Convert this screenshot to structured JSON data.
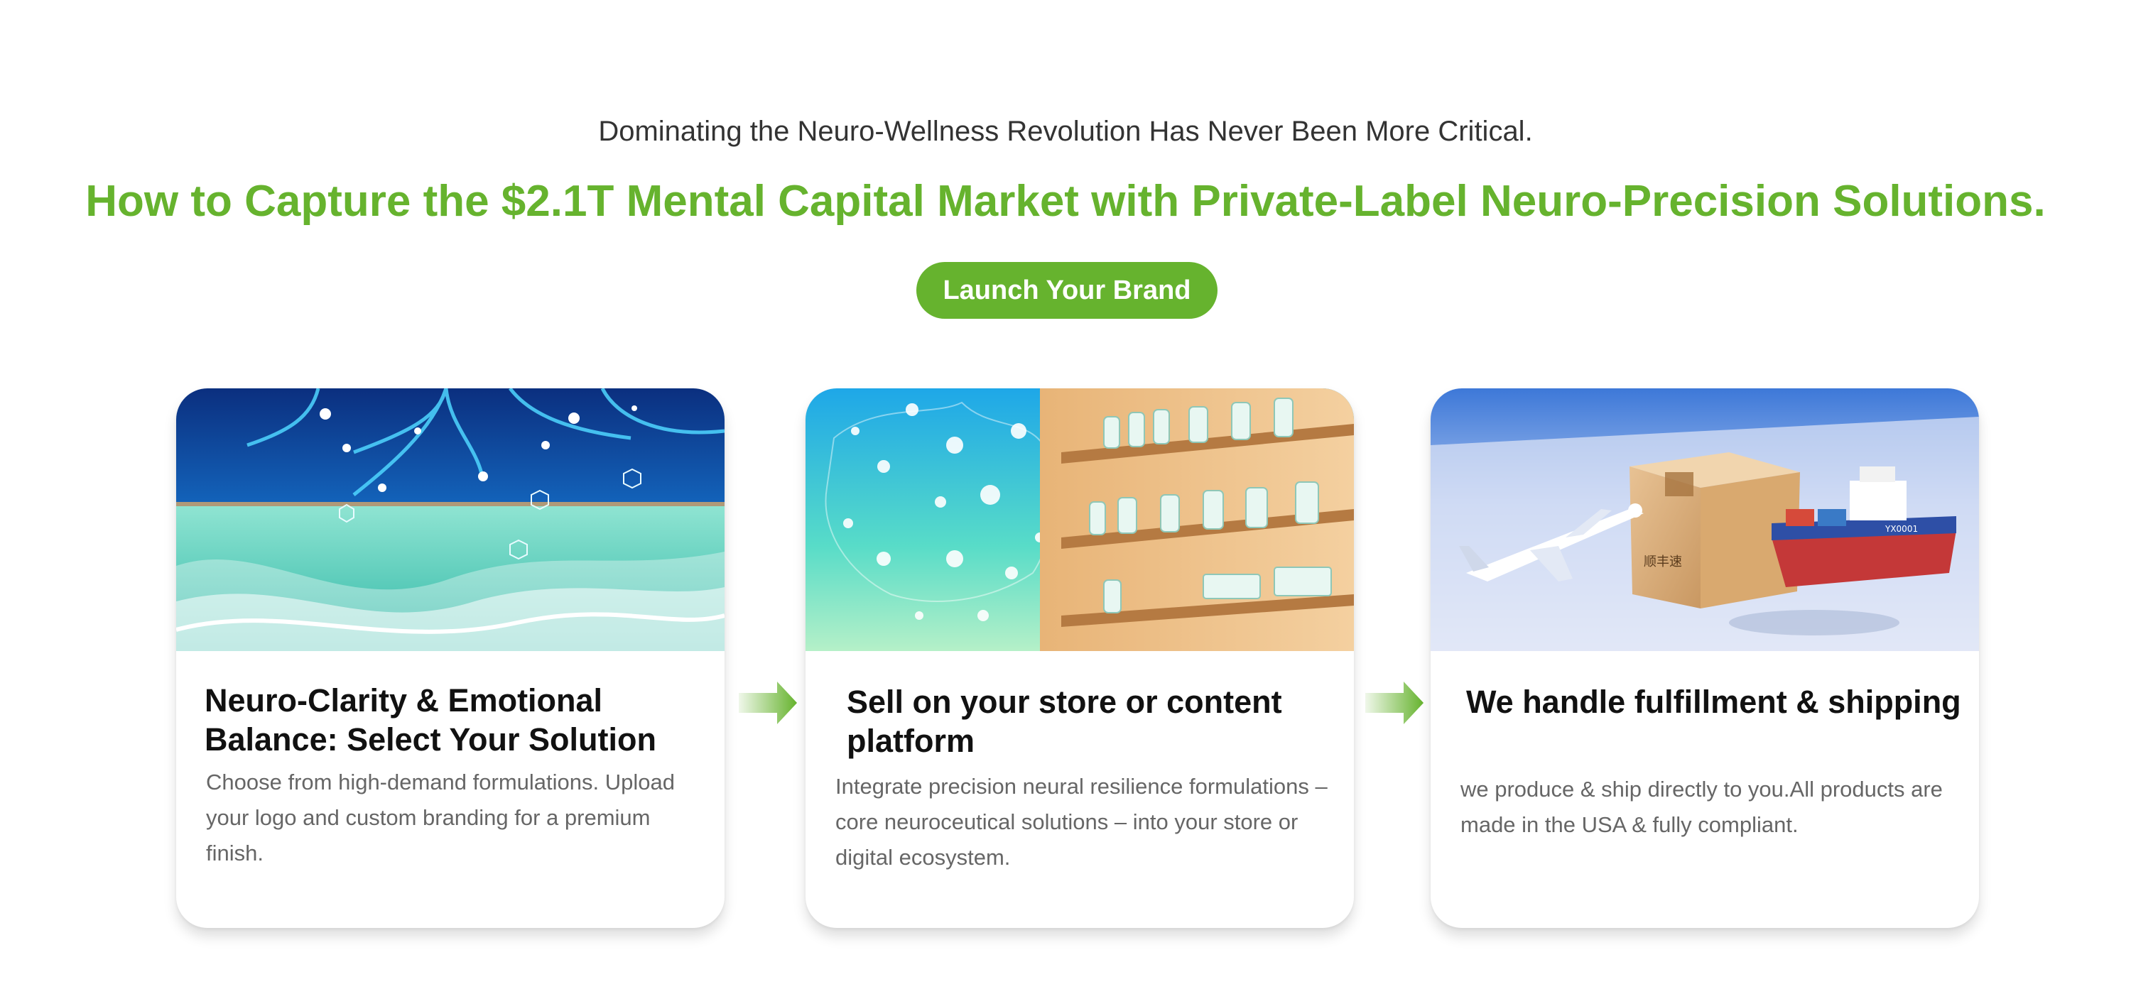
{
  "hero": {
    "kicker": "Dominating the Neuro-Wellness Revolution Has Never Been More Critical.",
    "headline": "How to Capture the $2.1T Mental Capital Market with Private-Label Neuro-Precision Solutions.",
    "cta_label": "Launch Your Brand"
  },
  "steps": [
    {
      "title": "Neuro-Clarity & Emotional Balance: Select Your Solution",
      "description": "Choose from high-demand formulations. Upload your logo and custom branding for a premium finish.",
      "image": "neural-wave-illustration"
    },
    {
      "title": "Sell on your store or content platform",
      "description": "Integrate precision neural resilience formulations –core neuroceutical solutions – into your store or digital ecosystem.",
      "image": "retail-shelf-illustration"
    },
    {
      "title": "We handle fulfillment & shipping",
      "description": "we produce & ship directly to you.All products are made in the USA & fully compliant.",
      "image": "shipping-illustration"
    }
  ],
  "box_label": "顺丰速",
  "ship_label": "YX0001",
  "colors": {
    "brand_green": "#66b32e",
    "title_text": "#111111",
    "body_text": "#666666",
    "kicker_text": "#333333"
  }
}
